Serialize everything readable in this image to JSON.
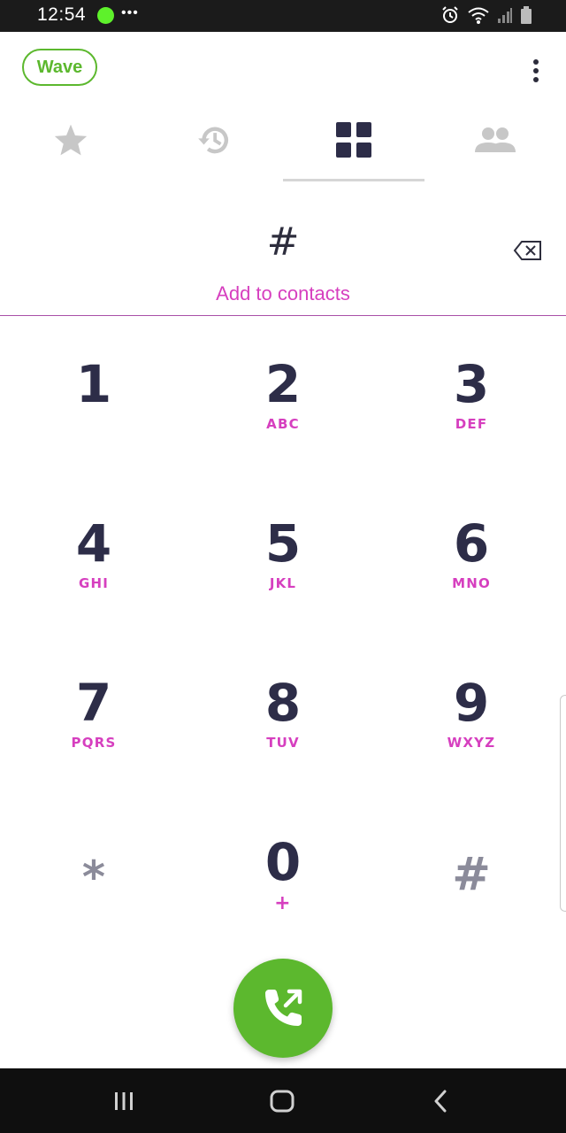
{
  "status_bar": {
    "time": "12:54",
    "more_indicator": "•••",
    "icons": [
      "green-dot-indicator",
      "alarm-icon",
      "wifi-icon",
      "signal-icon",
      "battery-icon"
    ]
  },
  "header": {
    "app_name": "Wave",
    "menu_icon": "more-vertical-icon"
  },
  "tabs": [
    {
      "name": "favorites",
      "icon": "star-icon",
      "selected": false
    },
    {
      "name": "recents",
      "icon": "history-icon",
      "selected": false
    },
    {
      "name": "keypad",
      "icon": "grid-icon",
      "selected": true
    },
    {
      "name": "contacts",
      "icon": "people-icon",
      "selected": false
    }
  ],
  "dialer": {
    "entered_number": "#",
    "add_to_contacts": "Add to contacts",
    "backspace_icon": "backspace-icon"
  },
  "keypad": [
    {
      "digit": "1",
      "letters": ""
    },
    {
      "digit": "2",
      "letters": "ABC"
    },
    {
      "digit": "3",
      "letters": "DEF"
    },
    {
      "digit": "4",
      "letters": "GHI"
    },
    {
      "digit": "5",
      "letters": "JKL"
    },
    {
      "digit": "6",
      "letters": "MNO"
    },
    {
      "digit": "7",
      "letters": "PQRS"
    },
    {
      "digit": "8",
      "letters": "TUV"
    },
    {
      "digit": "9",
      "letters": "WXYZ"
    },
    {
      "digit": "*",
      "letters": ""
    },
    {
      "digit": "0",
      "letters": "+"
    },
    {
      "digit": "#",
      "letters": ""
    }
  ],
  "call_button": {
    "icon": "phone-outgoing-icon"
  },
  "colors": {
    "brand_green": "#5cb82e",
    "accent_magenta": "#d63fbf",
    "digit_color": "#2d2d48",
    "inactive_icon": "#c7c7c7",
    "active_icon": "#2d2d48"
  },
  "nav_bar": {
    "buttons": [
      "recent-apps-icon",
      "home-icon",
      "back-icon"
    ]
  }
}
